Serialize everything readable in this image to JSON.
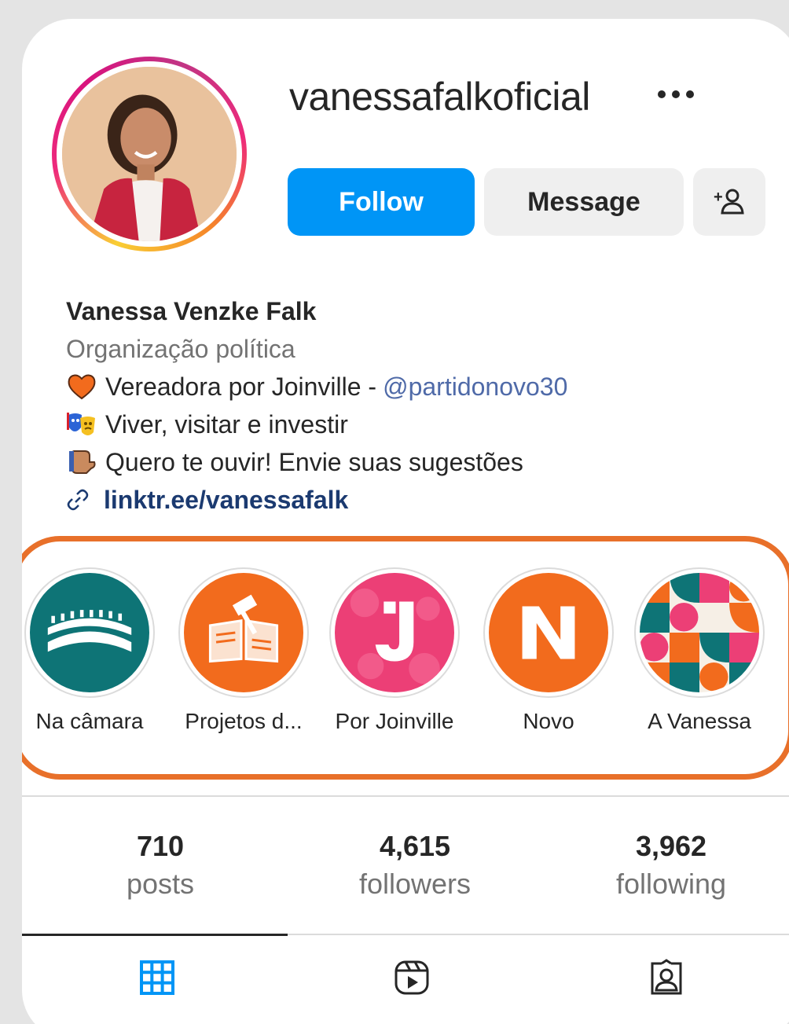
{
  "profile": {
    "username": "vanessafalkoficial",
    "more_icon": "more-horizontal-icon",
    "avatar_alt": "profile-photo"
  },
  "actions": {
    "follow_label": "Follow",
    "message_label": "Message",
    "add_user_icon": "add-person-icon"
  },
  "bio": {
    "full_name": "Vanessa Venzke Falk",
    "category": "Organização política",
    "line1_text": "Vereadora por Joinville -",
    "line1_mention": "@partidonovo30",
    "line2_text": "Viver, visitar e investir",
    "line3_text": "Quero te ouvir! Envie suas sugestões",
    "link": "linktr.ee/vanessafalk"
  },
  "highlights": [
    {
      "label": "Na câmara"
    },
    {
      "label": "Projetos d..."
    },
    {
      "label": "Por Joinville"
    },
    {
      "label": "Novo"
    },
    {
      "label": "A Vanessa"
    }
  ],
  "stats": {
    "posts_count": "710",
    "posts_label": "posts",
    "followers_count": "4,615",
    "followers_label": "followers",
    "following_count": "3,962",
    "following_label": "following"
  },
  "tabs": [
    {
      "icon": "grid-icon",
      "active": true
    },
    {
      "icon": "reels-icon",
      "active": false
    },
    {
      "icon": "tagged-icon",
      "active": false
    }
  ],
  "colors": {
    "primary_button": "#0095f6",
    "secondary_button": "#efefef",
    "mention": "#4f6aa8",
    "annotation_outline": "#e8702a",
    "grid_icon": "#0095f6"
  }
}
